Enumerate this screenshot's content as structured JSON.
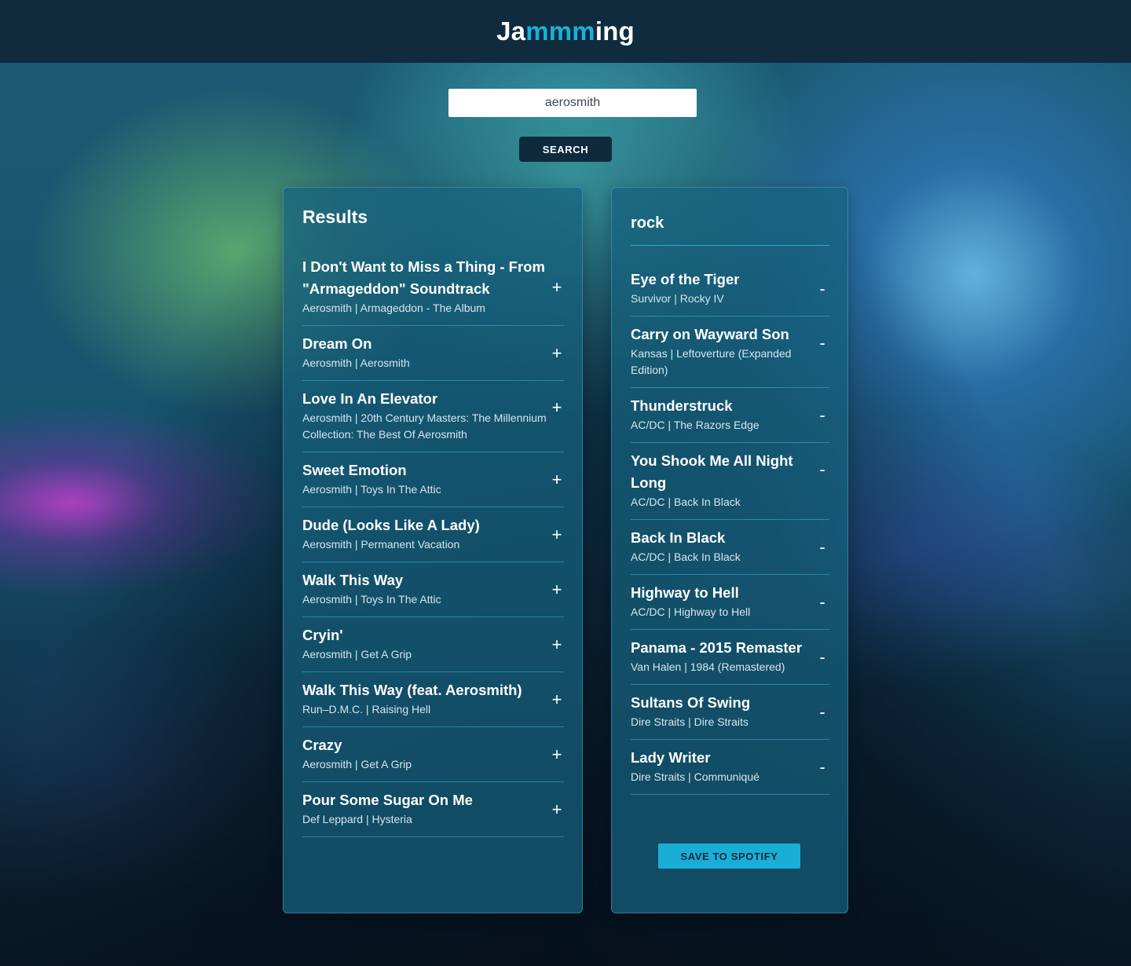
{
  "header": {
    "logo_prefix": "Ja",
    "logo_accent": "mmm",
    "logo_suffix": "ing"
  },
  "search": {
    "value": "aerosmith",
    "button_label": "SEARCH"
  },
  "results": {
    "title": "Results",
    "add_symbol": "+",
    "tracks": [
      {
        "name": "I Don't Want to Miss a Thing - From \"Armageddon\" Soundtrack",
        "info": "Aerosmith | Armageddon - The Album"
      },
      {
        "name": "Dream On",
        "info": "Aerosmith | Aerosmith"
      },
      {
        "name": "Love In An Elevator",
        "info": "Aerosmith | 20th Century Masters: The Millennium Collection: The Best Of Aerosmith"
      },
      {
        "name": "Sweet Emotion",
        "info": "Aerosmith | Toys In The Attic"
      },
      {
        "name": "Dude (Looks Like A Lady)",
        "info": "Aerosmith | Permanent Vacation"
      },
      {
        "name": "Walk This Way",
        "info": "Aerosmith | Toys In The Attic"
      },
      {
        "name": "Cryin'",
        "info": "Aerosmith | Get A Grip"
      },
      {
        "name": "Walk This Way (feat. Aerosmith)",
        "info": "Run–D.M.C. | Raising Hell"
      },
      {
        "name": "Crazy",
        "info": "Aerosmith | Get A Grip"
      },
      {
        "name": "Pour Some Sugar On Me",
        "info": "Def Leppard | Hysteria"
      }
    ]
  },
  "playlist": {
    "name": "rock",
    "remove_symbol": "-",
    "save_label": "SAVE TO SPOTIFY",
    "tracks": [
      {
        "name": "Eye of the Tiger",
        "info": "Survivor | Rocky IV"
      },
      {
        "name": "Carry on Wayward Son",
        "info": "Kansas | Leftoverture (Expanded Edition)"
      },
      {
        "name": "Thunderstruck",
        "info": "AC/DC | The Razors Edge"
      },
      {
        "name": "You Shook Me All Night Long",
        "info": "AC/DC | Back In Black"
      },
      {
        "name": "Back In Black",
        "info": "AC/DC | Back In Black"
      },
      {
        "name": "Highway to Hell",
        "info": "AC/DC | Highway to Hell"
      },
      {
        "name": "Panama - 2015 Remaster",
        "info": "Van Halen | 1984 (Remastered)"
      },
      {
        "name": "Sultans Of Swing",
        "info": "Dire Straits | Dire Straits"
      },
      {
        "name": "Lady Writer",
        "info": "Dire Straits | Communiqué"
      }
    ]
  },
  "colors": {
    "header_bg": "#0f2b3d",
    "accent": "#1ab0d8",
    "panel_bg": "#166280"
  }
}
